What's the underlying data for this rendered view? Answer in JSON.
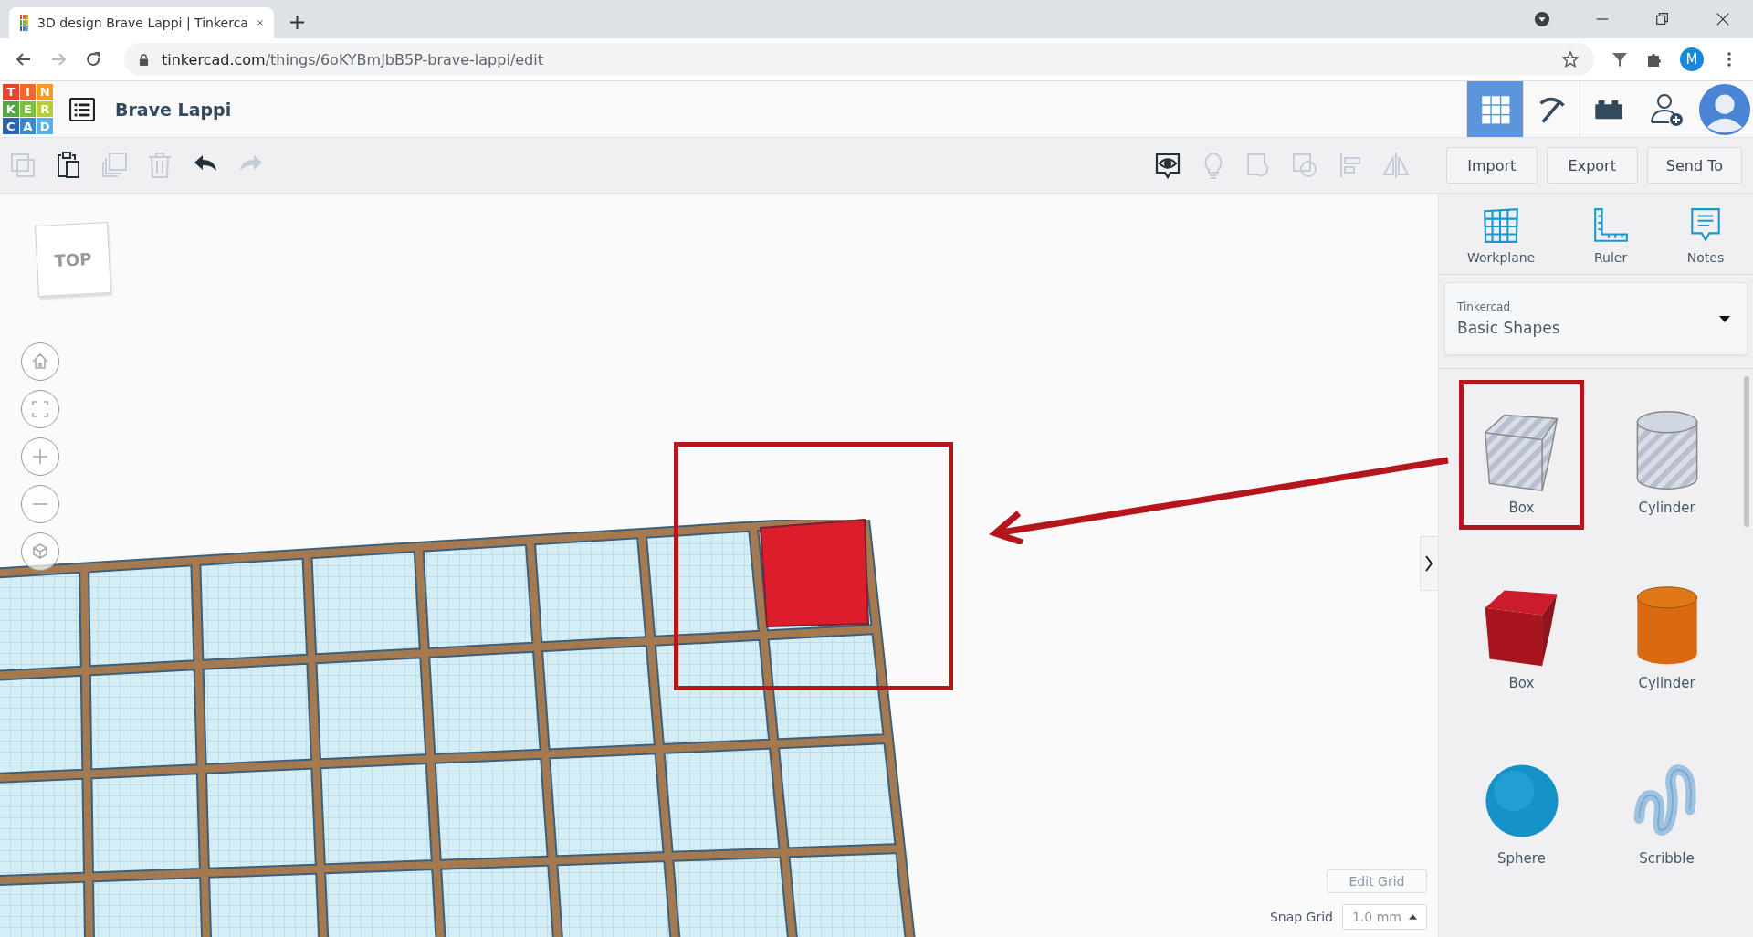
{
  "browser": {
    "tab_title": "3D design Brave Lappi | Tinkerca",
    "url_host": "tinkercad.com",
    "url_path": "/things/6oKYBmJbB5P-brave-lappi/edit",
    "profile_initial": "M"
  },
  "app": {
    "logo_letters": [
      "T",
      "I",
      "N",
      "K",
      "E",
      "R",
      "C",
      "A",
      "D"
    ],
    "design_name": "Brave Lappi"
  },
  "header_views": [
    {
      "kind": "grid",
      "selected": true
    },
    {
      "kind": "pickaxe",
      "selected": false
    },
    {
      "kind": "bricks",
      "selected": false
    }
  ],
  "edit_tools": [
    {
      "kind": "copy",
      "disabled": true
    },
    {
      "kind": "paste",
      "disabled": false
    },
    {
      "kind": "duplicate",
      "disabled": true
    },
    {
      "kind": "delete",
      "disabled": true
    },
    {
      "kind": "undo",
      "disabled": false
    },
    {
      "kind": "redo",
      "disabled": true
    }
  ],
  "view_tools": [
    {
      "kind": "eye",
      "disabled": false
    },
    {
      "kind": "bulb",
      "disabled": true
    },
    {
      "kind": "group",
      "disabled": true
    },
    {
      "kind": "ungroup",
      "disabled": true
    },
    {
      "kind": "align",
      "disabled": true
    },
    {
      "kind": "mirror",
      "disabled": true
    }
  ],
  "actions": [
    "Import",
    "Export",
    "Send To"
  ],
  "viewcube": "TOP",
  "view_controls": [
    {
      "kind": "home"
    },
    {
      "kind": "fit"
    },
    {
      "kind": "zoom-in"
    },
    {
      "kind": "zoom-out"
    },
    {
      "kind": "ortho"
    }
  ],
  "panel_tools": [
    {
      "kind": "workplane",
      "label": "Workplane"
    },
    {
      "kind": "ruler",
      "label": "Ruler"
    },
    {
      "kind": "notes",
      "label": "Notes"
    }
  ],
  "library": {
    "source": "Tinkercad",
    "category": "Basic Shapes"
  },
  "shapes": [
    {
      "kind": "box-hole",
      "label": "Box",
      "highlighted": true
    },
    {
      "kind": "cylinder-hole",
      "label": "Cylinder",
      "highlighted": false
    },
    {
      "kind": "box",
      "label": "Box",
      "highlighted": false
    },
    {
      "kind": "cylinder",
      "label": "Cylinder",
      "highlighted": false
    },
    {
      "kind": "sphere",
      "label": "Sphere",
      "highlighted": false
    },
    {
      "kind": "scribble",
      "label": "Scribble",
      "highlighted": false
    }
  ],
  "grid_controls": {
    "edit_grid": "Edit Grid",
    "snap_label": "Snap Grid",
    "snap_value": "1.0 mm"
  }
}
